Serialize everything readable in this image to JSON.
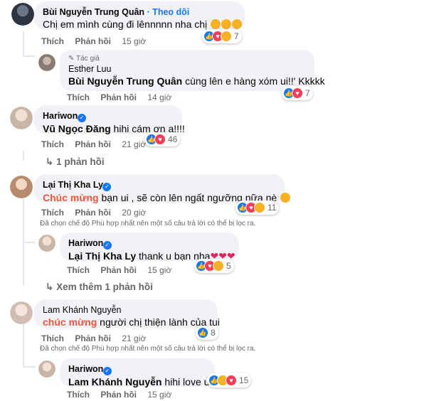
{
  "comments": {
    "c1": {
      "name": "Bùi Nguyễn Trung Quân",
      "follow": "· Theo dõi",
      "text": "Chị em mình cùng đi lênnnnn nha chị",
      "like": "Thích",
      "reply": "Phản hồi",
      "time": "15 giờ",
      "reactions": "7"
    },
    "c1r1": {
      "author_badge": "Tác giả",
      "name": "Esther Luu",
      "tag": "Bùi Nguyễn Trung Quân",
      "text": " cùng lên e hàng xóm ui!!' Kkkkk",
      "like": "Thích",
      "reply": "Phản hồi",
      "time": "14 giờ",
      "reactions": "7"
    },
    "c2": {
      "name": "Hariwon",
      "tag": "Vũ Ngọc Đăng",
      "text": " hihi cám ơn a!!!!",
      "like": "Thích",
      "reply": "Phản hồi",
      "time": "21 giờ",
      "reactions": "46",
      "replies_link": "1 phản hồi"
    },
    "c3": {
      "name": "Lại Thị Kha Ly",
      "hl": "Chúc mừng",
      "text": " bạn ui , sẽ còn lên ngất ngưỡng nữa nè",
      "like": "Thích",
      "reply": "Phản hồi",
      "time": "20 giờ",
      "reactions": "11",
      "filter_note": "Đã chọn chế độ Phù hợp nhất nên một số câu trả lời có thể bị lọc ra."
    },
    "c3r1": {
      "name": "Hariwon",
      "tag": "Lại Thị Kha Ly",
      "text": " thank u bạn nha",
      "like": "Thích",
      "reply": "Phản hồi",
      "time": "15 giờ",
      "reactions": "5",
      "more_link": "Xem thêm 1 phản hồi"
    },
    "c4": {
      "name": "Lam Khánh Nguyễn",
      "hl": "chúc mừng",
      "text": " người chị thiện lành của tui",
      "like": "Thích",
      "reply": "Phản hồi",
      "time": "21 giờ",
      "reactions": "8",
      "filter_note": "Đã chọn chế độ Phù hợp nhất nên một số câu trả lời có thể bị lọc ra."
    },
    "c4r1": {
      "name": "Hariwon",
      "tag": "Lam Khánh Nguyễn",
      "text": " hihi love u!!",
      "like": "Thích",
      "reply": "Phản hồi",
      "time": "15 giờ",
      "reactions": "15"
    }
  },
  "colors": {
    "bubble": "#f0f2f5",
    "link_blue": "#1877f2",
    "meta_gray": "#65676b",
    "highlight": "#e9573f"
  }
}
